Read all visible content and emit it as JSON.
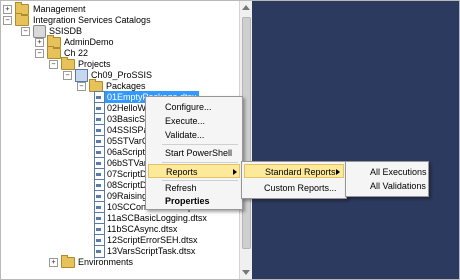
{
  "tree": {
    "nodes": [
      {
        "label": "Management",
        "expander": "+",
        "icon": "folder-icon"
      },
      {
        "label": "Integration Services Catalogs",
        "expander": "−",
        "icon": "folder-icon"
      },
      {
        "label": "SSISDB",
        "expander": "−",
        "icon": "database-icon"
      },
      {
        "label": "AdminDemo",
        "expander": "+",
        "icon": "folder-icon"
      },
      {
        "label": "Ch 22",
        "expander": "−",
        "icon": "folder-icon"
      },
      {
        "label": "Projects",
        "expander": "−",
        "icon": "folder-icon"
      },
      {
        "label": "Ch09_ProSSIS",
        "expander": "−",
        "icon": "project-icon"
      },
      {
        "label": "Packages",
        "expander": "−",
        "icon": "folder-icon"
      },
      {
        "label": "01EmptyPackage.dtsx",
        "selected": true
      },
      {
        "label": "02HelloWorld.dtsx"
      },
      {
        "label": "03BasicScriptTask.dtsx"
      },
      {
        "label": "04SSISPackageVariables.dtsx"
      },
      {
        "label": "05STVarCollection.dtsx"
      },
      {
        "label": "06aScriptDataFlow.dtsx"
      },
      {
        "label": "06bSTVariables.dtsx"
      },
      {
        "label": "07ScriptDataFlow.dtsx"
      },
      {
        "label": "08ScriptDataFlow.dtsx"
      },
      {
        "label": "09RaisingEvents.dtsx"
      },
      {
        "label": "10SCContactsExample.dtsx"
      },
      {
        "label": "11aSCBasicLogging.dtsx"
      },
      {
        "label": "11bSCAsync.dtsx"
      },
      {
        "label": "12ScriptErrorSEH.dtsx"
      },
      {
        "label": "13VarsScriptTask.dtsx"
      },
      {
        "label": "Environments",
        "expander": "+",
        "icon": "folder-icon"
      }
    ]
  },
  "context_menu": {
    "items": [
      "Configure...",
      "Execute...",
      "Validate...",
      "Start PowerShell",
      "Reports",
      "Refresh",
      "Properties"
    ]
  },
  "reports_menu": {
    "items": [
      "Standard Reports",
      "Custom Reports..."
    ]
  },
  "standard_reports_menu": {
    "items": [
      "All Executions",
      "All Validations"
    ]
  },
  "colors": {
    "desktop": "#2d3a5f",
    "selection": "#3399ff",
    "menu_highlight": "#fde99a"
  }
}
